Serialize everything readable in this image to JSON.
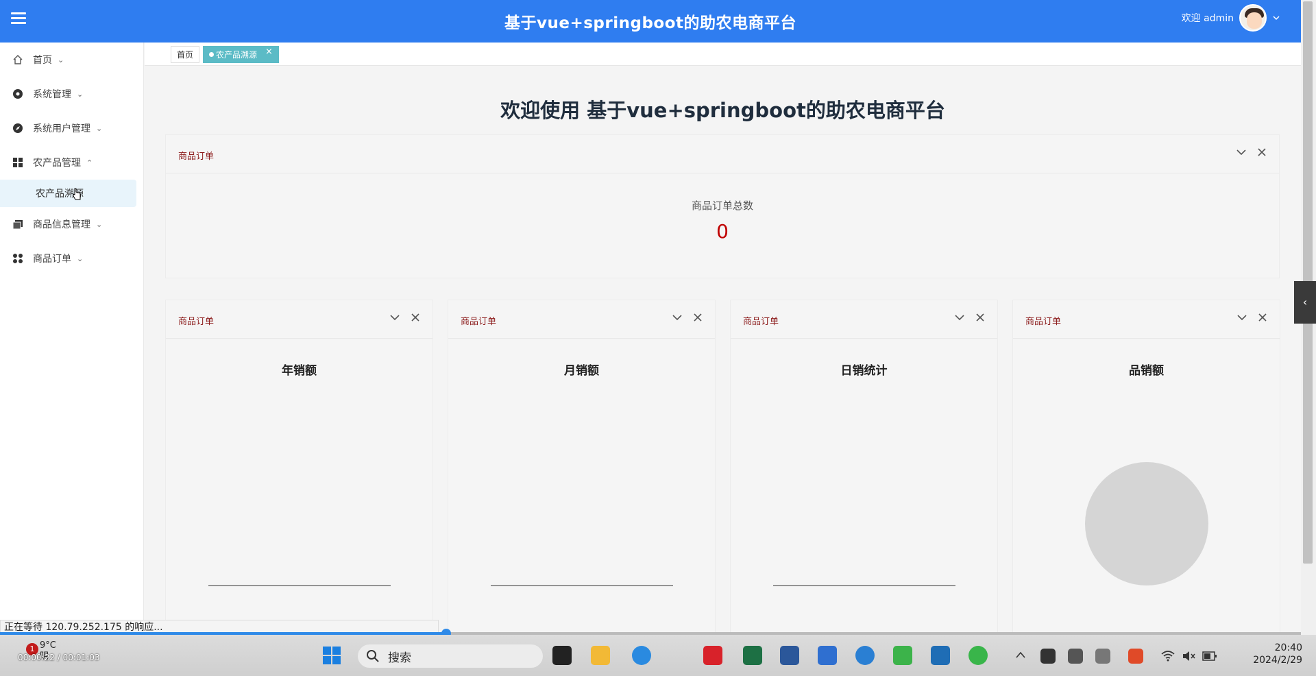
{
  "header": {
    "title": "基于vue+springboot的助农电商平台",
    "welcome": "欢迎 admin"
  },
  "sidebar": {
    "items": [
      {
        "label": "首页",
        "chevron": "⌄"
      },
      {
        "label": "系统管理",
        "chevron": "⌄"
      },
      {
        "label": "系统用户管理",
        "chevron": "⌄"
      },
      {
        "label": "农产品管理",
        "chevron": "⌃"
      },
      {
        "label": "农产品溯源"
      },
      {
        "label": "商品信息管理",
        "chevron": "⌄"
      },
      {
        "label": "商品订单",
        "chevron": "⌄"
      }
    ]
  },
  "tabs": [
    {
      "label": "首页"
    },
    {
      "label": "农产品溯源",
      "close": "×"
    }
  ],
  "main": {
    "welcome_title": "欢迎使用 基于vue+springboot的助农电商平台",
    "total_card": {
      "title": "商品订单",
      "label": "商品订单总数",
      "value": "0"
    },
    "chart_cards": [
      {
        "title": "商品订单",
        "chart_title": "年销额"
      },
      {
        "title": "商品订单",
        "chart_title": "月销额"
      },
      {
        "title": "商品订单",
        "chart_title": "日销统计"
      },
      {
        "title": "商品订单",
        "chart_title": "品销额"
      }
    ]
  },
  "status_bar": {
    "text": "正在等待 120.79.252.175 的响应..."
  },
  "video": {
    "timecode": "00:00:22 / 00:01:03",
    "progress": 0.343
  },
  "taskbar": {
    "weather_temp": "9°C",
    "weather_desc": "阴",
    "badge": "1",
    "search_placeholder": "搜索",
    "time": "20:40",
    "date": "2024/2/29"
  },
  "colors": {
    "header": "#2f7df0",
    "accent_tab": "#5bbbc6",
    "card_title": "#8b1a1a",
    "total_value": "#c00000"
  }
}
